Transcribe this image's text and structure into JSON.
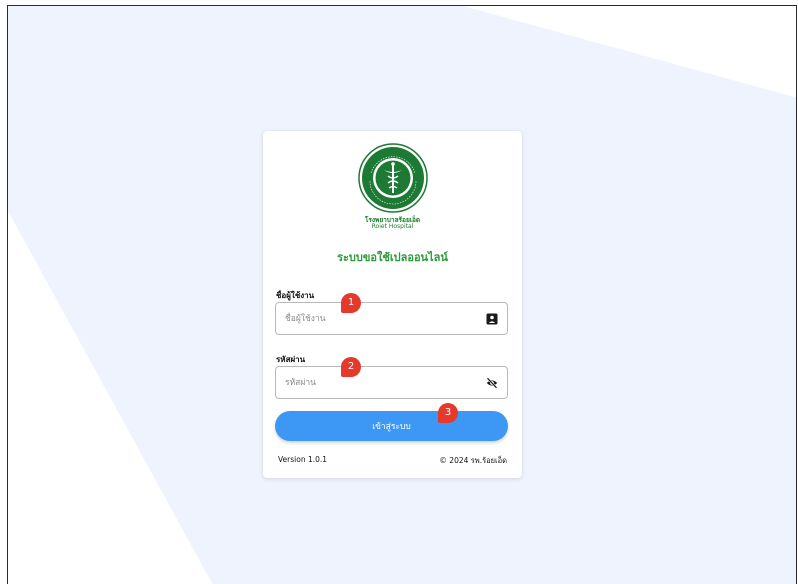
{
  "colors": {
    "background_shape": "#eef3fd",
    "accent": "#3d97f4",
    "brand_green": "#2e9a3a",
    "marker": "#e5392b"
  },
  "logo": {
    "icon": "ministry-of-public-health-seal-icon",
    "hospital_name_th": "โรงพยาบาลร้อยเอ็ด",
    "hospital_name_en": "Roiet Hospital"
  },
  "system_title": "ระบบขอใช้เปลออนไลน์",
  "form": {
    "username": {
      "label": "ชื่อผู้ใช้งาน",
      "placeholder": "ชื่อผู้ใช้งาน",
      "value": "",
      "icon": "id-card-icon"
    },
    "password": {
      "label": "รหัสผ่าน",
      "placeholder": "รหัสผ่าน",
      "value": "",
      "icon": "eye-off-icon"
    },
    "submit_label": "เข้าสู่ระบบ"
  },
  "footer": {
    "version": "Version 1.0.1",
    "copyright": "© 2024 รพ.ร้อยเอ็ด"
  },
  "annotations": [
    "1",
    "2",
    "3"
  ]
}
